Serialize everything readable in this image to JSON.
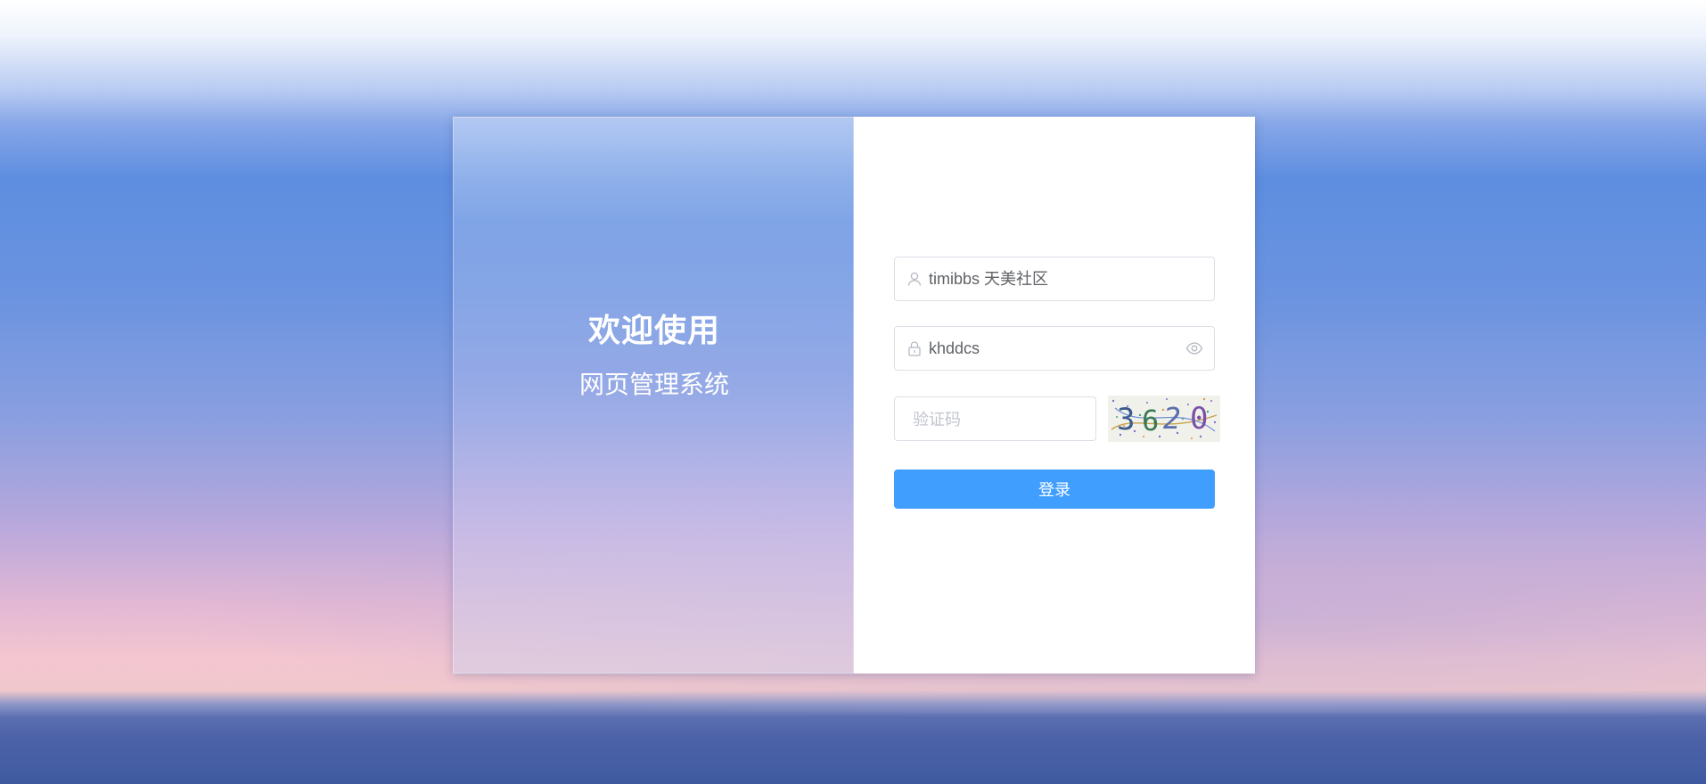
{
  "welcome": {
    "title": "欢迎使用",
    "subtitle": "网页管理系统"
  },
  "login_form": {
    "username_value": "timibbs 天美社区",
    "password_value": "khddcs",
    "captcha_placeholder": "验证码",
    "captcha_image_text": "3620",
    "submit_label": "登录",
    "icons": {
      "username": "user-icon",
      "password": "lock-icon",
      "reveal": "eye-icon"
    }
  },
  "colors": {
    "primary_button": "#409eff",
    "input_border": "#dcdfe6",
    "input_text": "#606266",
    "placeholder": "#c0c4cc"
  }
}
